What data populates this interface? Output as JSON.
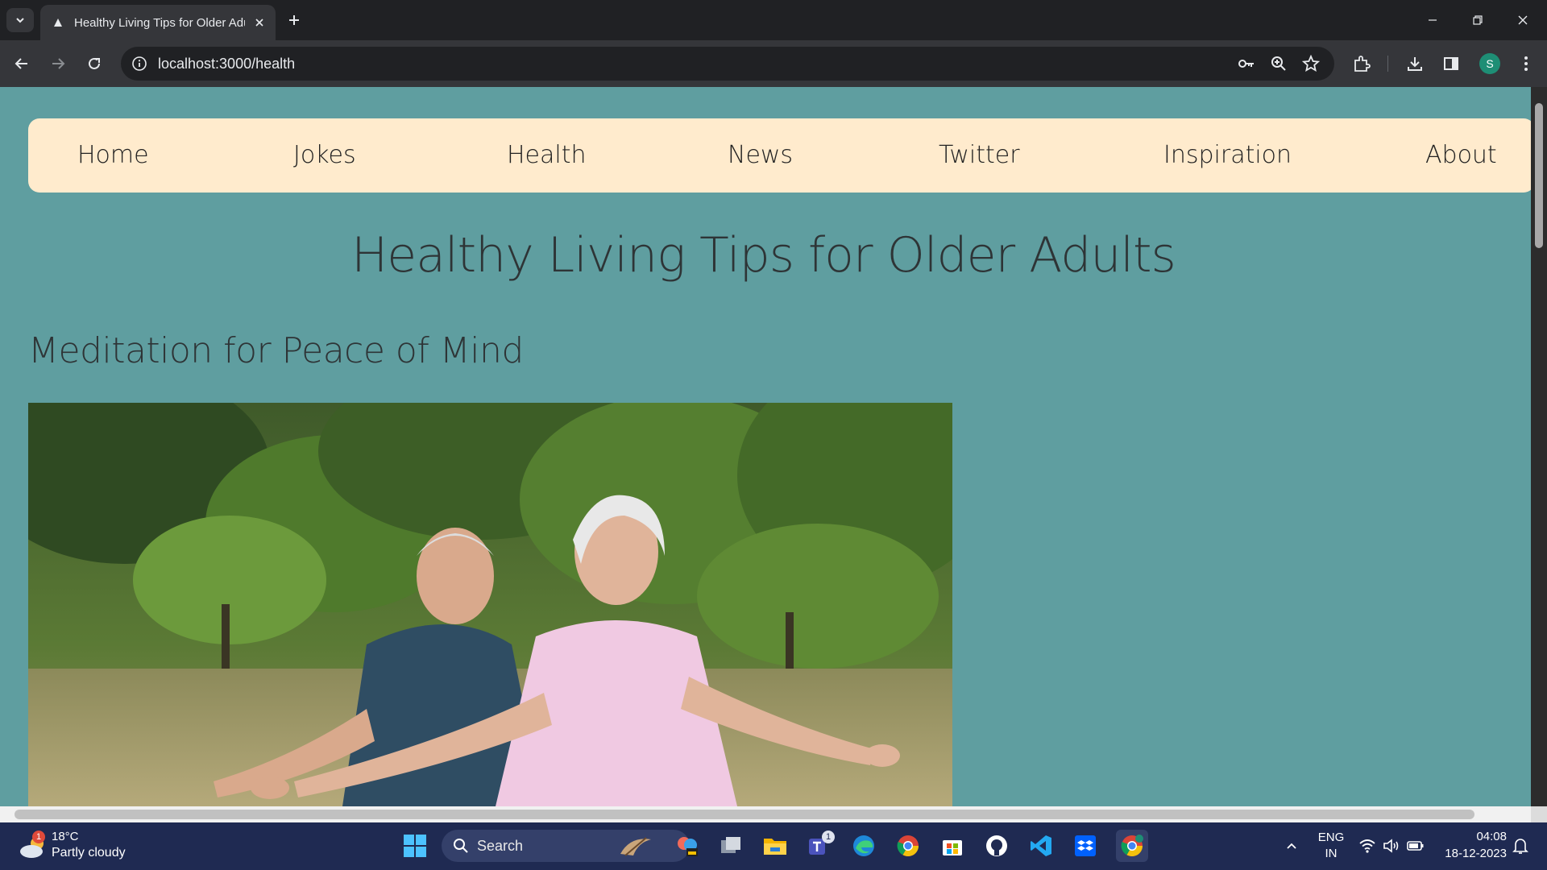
{
  "browser": {
    "tab_title": "Healthy Living Tips for Older Adults",
    "url": "localhost:3000/health",
    "profile_initial": "S"
  },
  "page": {
    "nav": [
      "Home",
      "Jokes",
      "Health",
      "News",
      "Twitter",
      "Inspiration",
      "About"
    ],
    "title": "Healthy Living Tips for Older Adults",
    "section_title": "Meditation for Peace of Mind"
  },
  "taskbar": {
    "weather_badge": "1",
    "temperature": "18°C",
    "weather": "Partly cloudy",
    "search_label": "Search",
    "teams_badge": "1",
    "language": "ENG",
    "region": "IN",
    "time": "04:08",
    "date": "18-12-2023"
  },
  "colors": {
    "page_background": "#5f9ea0",
    "navbar_background": "#ffebcd",
    "taskbar": "#1f2a52"
  }
}
